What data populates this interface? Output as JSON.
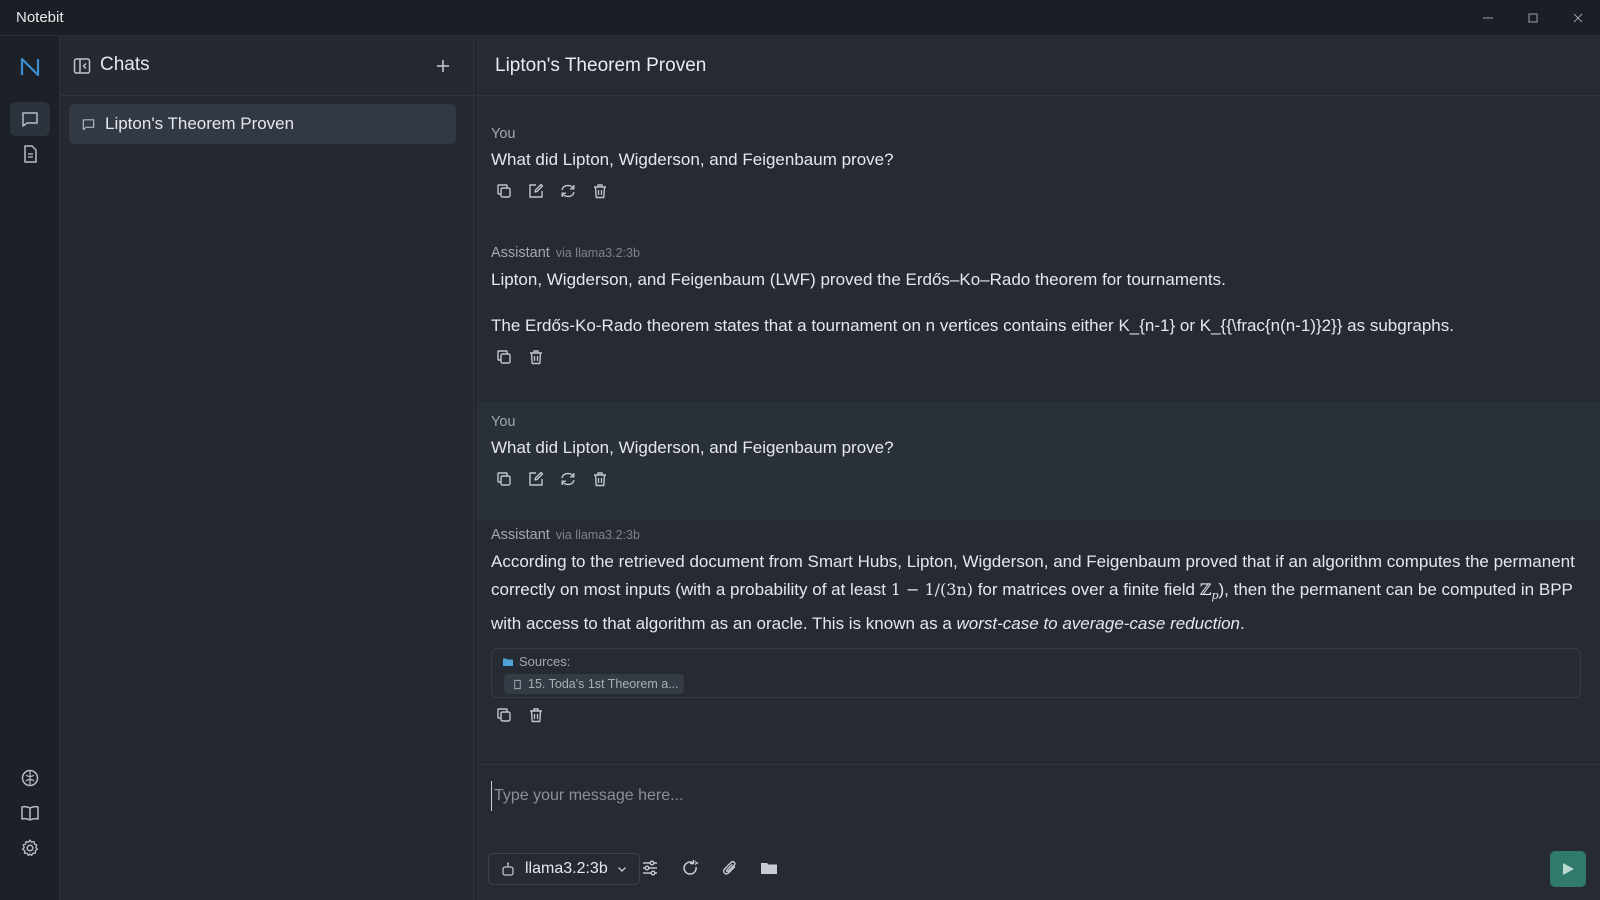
{
  "window": {
    "title": "Notebit"
  },
  "sidebar": {
    "title": "Chats",
    "chats": [
      {
        "label": "Lipton's Theorem Proven"
      }
    ]
  },
  "main": {
    "title": "Lipton's Theorem Proven",
    "messages": [
      {
        "author": "You",
        "text": "What did Lipton, Wigderson, and Feigenbaum prove?"
      },
      {
        "author": "Assistant",
        "via": "via llama3.2:3b",
        "paragraph1": "Lipton, Wigderson, and Feigenbaum (LWF) proved the Erdős–Ko–Rado theorem for tournaments.",
        "paragraph2": "The Erdős-Ko-Rado theorem states that a tournament on n vertices contains either K_{n-1} or K_{{\\frac{n(n-1)}2}} as subgraphs."
      },
      {
        "author": "You",
        "text": "What did Lipton, Wigderson, and Feigenbaum prove?"
      },
      {
        "author": "Assistant",
        "via": "via llama3.2:3b",
        "text_part1": "According to the retrieved document from Smart Hubs, Lipton, Wigderson, and Feigenbaum proved that if an algorithm computes the permanent correctly on most inputs (with a probability of at least ",
        "math1": "1 − 1/(3n)",
        "text_part2": " for matrices over a finite field ",
        "math2": "ℤ",
        "math2_sub": "p",
        "text_part3": "), then the permanent can be computed in BPP with access to that algorithm as an oracle. This is known as a ",
        "text_italic": "worst-case to average-case reduction",
        "text_end": ".",
        "sources_label": "Sources:",
        "source_chip": "15. Toda's 1st Theorem a..."
      }
    ]
  },
  "composer": {
    "placeholder": "Type your message here...",
    "model": "llama3.2:3b"
  },
  "colors": {
    "accent": "#2f7a6a",
    "logo": "#3b8fd0"
  }
}
